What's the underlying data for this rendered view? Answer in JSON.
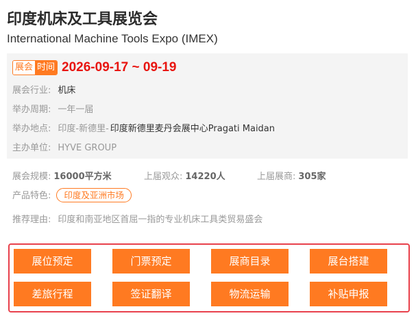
{
  "title_cn": "印度机床及工具展览会",
  "title_en": "International Machine Tools Expo (IMEX)",
  "date_tag": {
    "part1": "展会",
    "part2": "时间"
  },
  "date_text": "2026-09-17 ~ 09-19",
  "info": {
    "industry": {
      "label": "展会行业:",
      "value": "机床"
    },
    "cycle": {
      "label": "举办周期:",
      "value": "一年一届"
    },
    "location": {
      "label": "举办地点:",
      "city": "印度-新德里-",
      "venue": "印度新德里麦丹会展中心Pragati Maidan"
    },
    "organizer": {
      "label": "主办单位:",
      "value": "HYVE GROUP"
    }
  },
  "stats": {
    "scale": {
      "label": "展会规模:",
      "value": "16000平方米"
    },
    "visitors": {
      "label": "上届观众:",
      "value": "14220人"
    },
    "exhibitors": {
      "label": "上届展商:",
      "value": "305家"
    }
  },
  "features": {
    "label": "产品特色:",
    "tag": "印度及亚洲市场"
  },
  "recommend": {
    "label": "推荐理由:",
    "value": "印度和南亚地区首屈一指的专业机床工具类贸易盛会"
  },
  "buttons": [
    "展位预定",
    "门票预定",
    "展商目录",
    "展台搭建",
    "差旅行程",
    "签证翻译",
    "物流运输",
    "补贴申报"
  ],
  "colors": {
    "accent": "#ff7a21",
    "date_red": "#e8140f",
    "box_border": "#e8404b"
  }
}
